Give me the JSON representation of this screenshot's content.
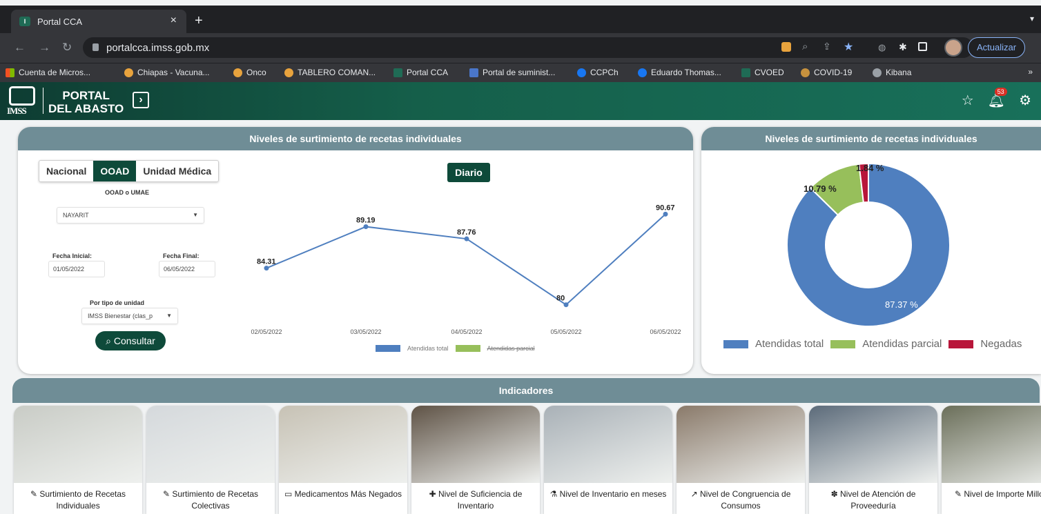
{
  "browser": {
    "tab_title": "Portal CCA",
    "tab_icon": "imss-favicon-icon",
    "url": "portalcca.imss.gob.mx",
    "update_label": "Actualizar",
    "bookmarks": [
      {
        "label": "Cuenta de Micros...",
        "icon": "microsoft-icon",
        "color": "#f25022"
      },
      {
        "label": "Chiapas - Vacuna...",
        "icon": "sun-icon",
        "color": "#e8a33d"
      },
      {
        "label": "Onco",
        "icon": "sun-icon",
        "color": "#e8a33d"
      },
      {
        "label": "TABLERO COMAN...",
        "icon": "sun-icon",
        "color": "#e8a33d"
      },
      {
        "label": "Portal CCA",
        "icon": "imss-icon",
        "color": "#1f6b55"
      },
      {
        "label": "Portal de suminist...",
        "icon": "portal-icon",
        "color": "#4a76c9"
      },
      {
        "label": "CCPCh",
        "icon": "facebook-icon",
        "color": "#1877f2"
      },
      {
        "label": "Eduardo Thomas...",
        "icon": "facebook-icon",
        "color": "#1877f2"
      },
      {
        "label": "CVOED",
        "icon": "imss-icon",
        "color": "#1f6b55"
      },
      {
        "label": "COVID-19",
        "icon": "circle-icon",
        "color": "#c7923e"
      },
      {
        "label": "Kibana",
        "icon": "globe-icon",
        "color": "#9aa0a6"
      }
    ]
  },
  "header": {
    "logo_text": "IMSS",
    "portal_line1": "PORTAL",
    "portal_line2": "DEL ABASTO",
    "notifications": "53"
  },
  "left_card": {
    "title": "Niveles de surtimiento de recetas individuales",
    "segments": [
      "Nacional",
      "OOAD",
      "Unidad Médica"
    ],
    "active_segment": "OOAD",
    "ooad_label": "OOAD o UMAE",
    "ooad_value": "NAYARIT",
    "fecha_inicial_label": "Fecha Inicial:",
    "fecha_inicial": "01/05/2022",
    "fecha_final_label": "Fecha Final:",
    "fecha_final": "06/05/2022",
    "tipo_label": "Por tipo de unidad",
    "tipo_value": "IMSS Bienestar (clas_p",
    "consultar_label": "Consultar",
    "diario_label": "Diario"
  },
  "chart_data": [
    {
      "type": "line",
      "x": [
        "02/05/2022",
        "03/05/2022",
        "04/05/2022",
        "05/05/2022",
        "06/05/2022"
      ],
      "series": [
        {
          "name": "Atendidas total",
          "values": [
            84.31,
            89.19,
            87.76,
            80,
            90.67
          ],
          "color": "#4f7fbf"
        },
        {
          "name": "Atendidas parcial",
          "values": [],
          "color": "#97bf5b",
          "hidden": true
        }
      ],
      "data_labels": [
        "84.31",
        "89.19",
        "87.76",
        "80",
        "90.67"
      ]
    },
    {
      "type": "pie",
      "title": "Niveles de surtimiento de recetas individuales",
      "slices": [
        {
          "name": "Atendidas total",
          "value": 87.37,
          "label": "87.37 %",
          "color": "#4f7fbf"
        },
        {
          "name": "Atendidas parcial",
          "value": 10.79,
          "label": "10.79 %",
          "color": "#97bf5b"
        },
        {
          "name": "Negadas",
          "value": 1.84,
          "label": "1.84 %",
          "color": "#b8163a"
        }
      ]
    }
  ],
  "indicadores": {
    "title": "Indicadores",
    "cards": [
      {
        "icon": "syringe-icon",
        "glyph": "✎",
        "label": "Surtimiento de Recetas Individuales",
        "bg": "#c9ccc6"
      },
      {
        "icon": "syringe-icon",
        "glyph": "✎",
        "label": "Surtimiento de Recetas Colectivas",
        "bg": "#d5d9dc"
      },
      {
        "icon": "folder-open-icon",
        "glyph": "▭",
        "label": "Medicamentos Más Negados",
        "bg": "#c7c2b5"
      },
      {
        "icon": "plus-icon",
        "glyph": "✚",
        "label": "Nivel de Suficiencia de Inventario",
        "bg": "#5f5346"
      },
      {
        "icon": "flask-icon",
        "glyph": "⚗",
        "label": "Nivel de Inventario en meses",
        "bg": "#a9b1b7"
      },
      {
        "icon": "chart-line-icon",
        "glyph": "↗",
        "label": "Nivel de Congruencia de Consumos",
        "bg": "#8a7a6a"
      },
      {
        "icon": "users-icon",
        "glyph": "✽",
        "label": "Nivel de Atención de Proveeduría",
        "bg": "#5c6b7a"
      },
      {
        "icon": "syringe-icon",
        "glyph": "✎",
        "label": "Nivel de Importe Millones",
        "bg": "#6b6f5a"
      }
    ]
  }
}
